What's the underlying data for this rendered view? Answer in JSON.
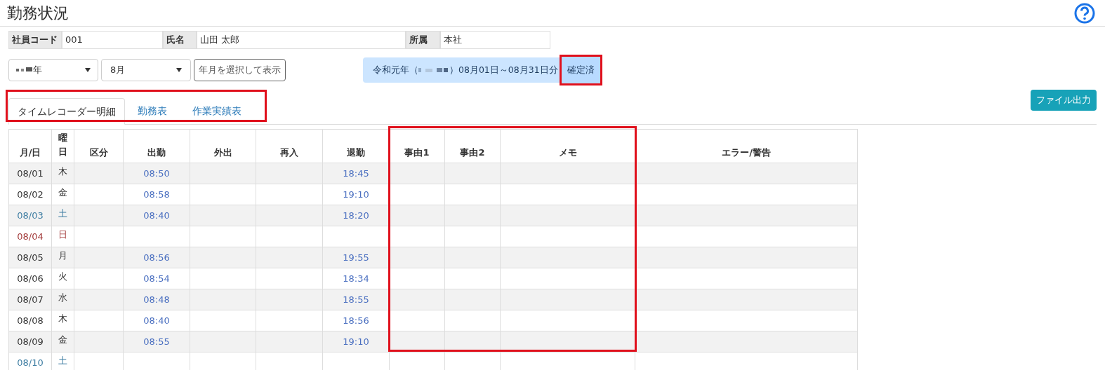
{
  "page_title": "勤務状況",
  "employee": [
    {
      "label": "社員コード",
      "value": "001"
    },
    {
      "label": "氏名",
      "value": "山田 太郎"
    },
    {
      "label": "所属",
      "value": "本社"
    }
  ],
  "year_select": {
    "value": "年"
  },
  "month_select": {
    "value": "8月"
  },
  "show_button": "年月を選択して表示",
  "period": {
    "prefix": "令和元年（",
    "suffix": "）08月01日～08月31日分",
    "status": "確定済"
  },
  "tabs": [
    {
      "label": "タイムレコーダー明細",
      "selected": true
    },
    {
      "label": "勤務表",
      "selected": false
    },
    {
      "label": "作業実績表",
      "selected": false
    }
  ],
  "export_button": "ファイル出力",
  "table": {
    "columns": [
      "月/日",
      "曜日",
      "区分",
      "出勤",
      "外出",
      "再入",
      "退勤",
      "事由1",
      "事由2",
      "メモ",
      "エラー/警告"
    ],
    "rows": [
      {
        "date": "08/01",
        "weekday": "木",
        "kind": "weekday",
        "in": "08:50",
        "out": "18:45"
      },
      {
        "date": "08/02",
        "weekday": "金",
        "kind": "weekday",
        "in": "08:58",
        "out": "19:10"
      },
      {
        "date": "08/03",
        "weekday": "土",
        "kind": "saturday",
        "in": "08:40",
        "out": "18:20"
      },
      {
        "date": "08/04",
        "weekday": "日",
        "kind": "sunday"
      },
      {
        "date": "08/05",
        "weekday": "月",
        "kind": "weekday",
        "in": "08:56",
        "out": "19:55"
      },
      {
        "date": "08/06",
        "weekday": "火",
        "kind": "weekday",
        "in": "08:54",
        "out": "18:34"
      },
      {
        "date": "08/07",
        "weekday": "水",
        "kind": "weekday",
        "in": "08:48",
        "out": "18:55"
      },
      {
        "date": "08/08",
        "weekday": "木",
        "kind": "weekday",
        "in": "08:40",
        "out": "18:56"
      },
      {
        "date": "08/09",
        "weekday": "金",
        "kind": "weekday",
        "in": "08:55",
        "out": "19:10"
      },
      {
        "date": "08/10",
        "weekday": "土",
        "kind": "saturday"
      }
    ]
  }
}
